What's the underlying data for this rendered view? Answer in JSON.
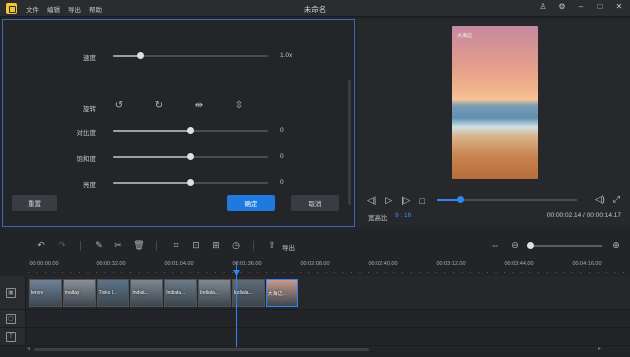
{
  "window": {
    "menu": [
      "文件",
      "编辑",
      "导出",
      "帮助"
    ],
    "title": "未命名",
    "controls": [
      "user-icon",
      "settings-icon",
      "minimize-icon",
      "maximize-icon",
      "close-icon"
    ]
  },
  "adjust": {
    "speed_label": "速度",
    "speed_value": "1.0x",
    "rotate_label": "旋转",
    "contrast_label": "对比度",
    "contrast_value": "0",
    "saturation_label": "饱和度",
    "saturation_value": "0",
    "brightness_label": "亮度",
    "brightness_value": "0",
    "speed_level": 0.18,
    "contrast_level": 0.5,
    "saturation_level": 0.5,
    "brightness_level": 0.5,
    "reset_label": "重置",
    "ok_label": "确定",
    "cancel_label": "取消"
  },
  "preview": {
    "watermark": "大海边",
    "ratio_label": "宽高比",
    "ratio_value": "9 : 16",
    "timecode": "00:00:02.14 / 00:00:14.17",
    "progress": 0.17
  },
  "toolbar": {
    "export_label": "导出",
    "zoom_level": 0.05
  },
  "timeline": {
    "ticks": [
      "00:00:00.00",
      "00:00:32.00",
      "00:01:04.00",
      "00:01:36.00",
      "00:02:08.00",
      "00:02:40.00",
      "00:03:12.00",
      "00:03:44.00",
      "00:04:16.00"
    ],
    "clips": [
      {
        "label": "lenov",
        "color": "#6f8397"
      },
      {
        "label": "maltay",
        "color": "#8a8f96"
      },
      {
        "label": "Tisko l...",
        "color": "#5d7388"
      },
      {
        "label": "Indiat...",
        "color": "#7d8790"
      },
      {
        "label": "Indiala...",
        "color": "#6b7a86"
      },
      {
        "label": "Indiala...",
        "color": "#818890"
      },
      {
        "label": "Indiala...",
        "color": "#5e6c78"
      },
      {
        "label": "大海边...",
        "color": "#c99a8c"
      }
    ],
    "playhead_time": "00:01:36.00"
  },
  "colors": {
    "accent": "#2e86f0",
    "panel_border": "#3a6db0",
    "ok_button": "#1f7ae0"
  }
}
